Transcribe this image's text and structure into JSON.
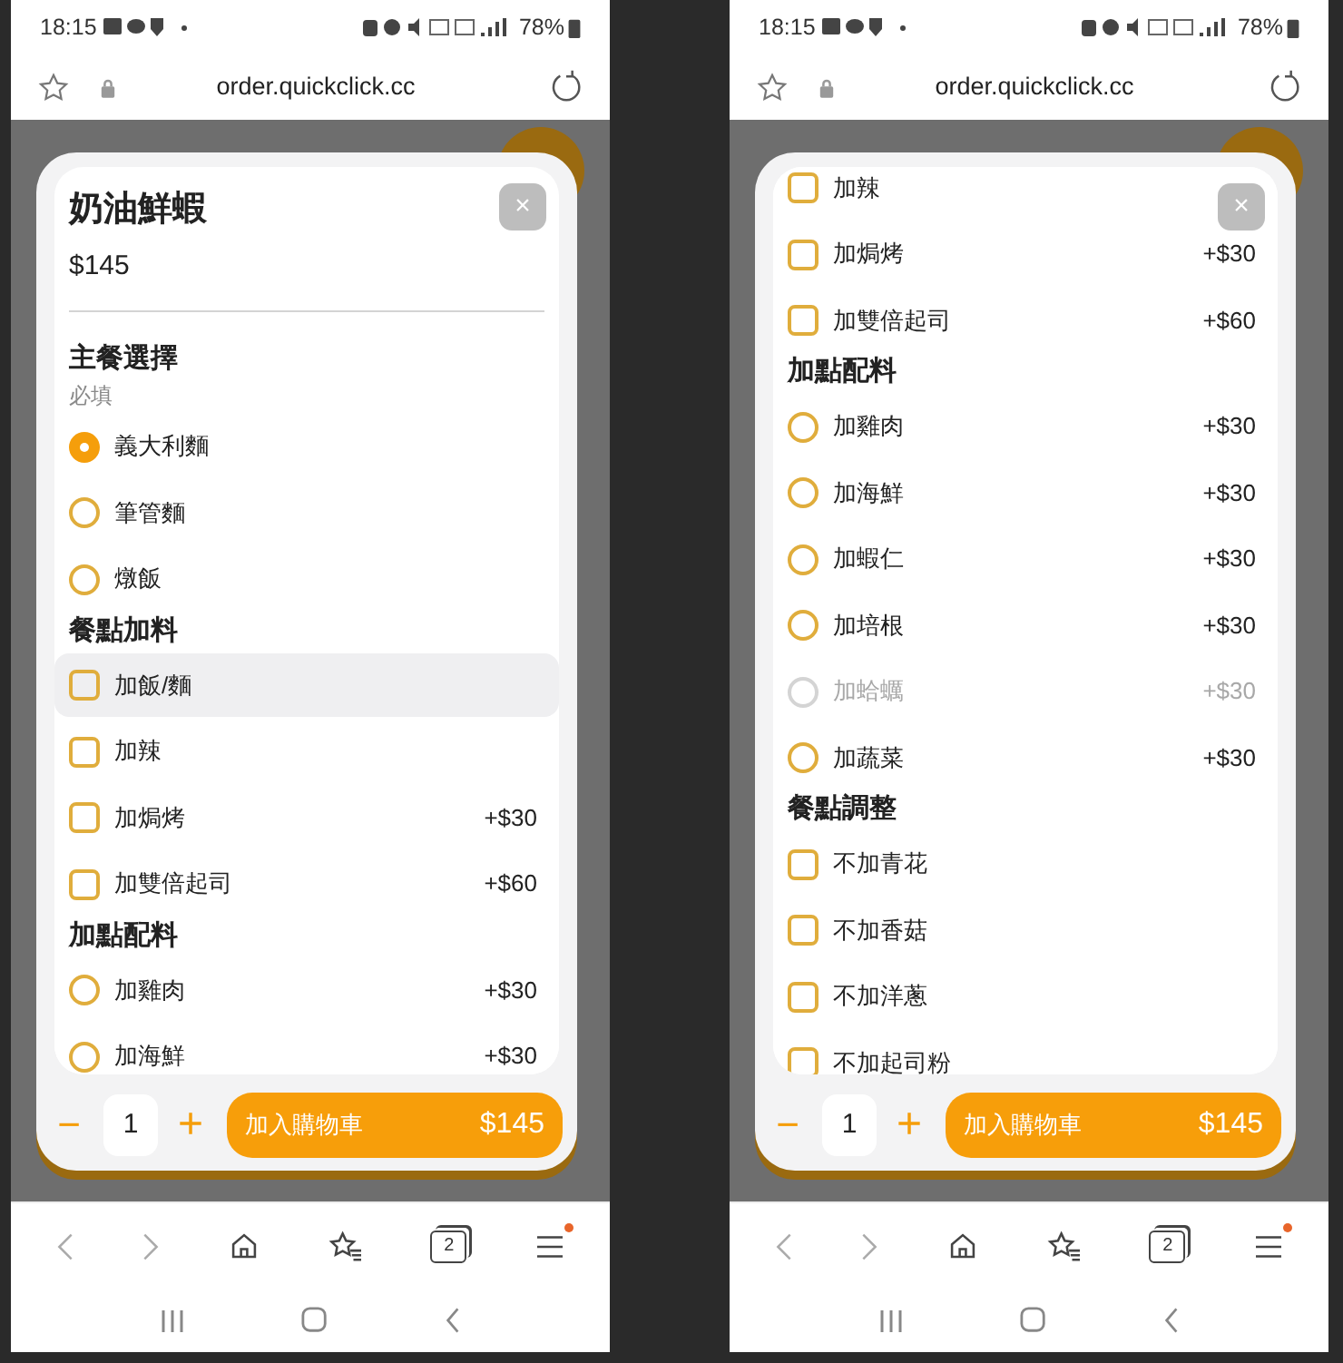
{
  "screens": [
    {
      "status_bar": {
        "time": "18:15",
        "battery": "78%"
      },
      "address_bar": {
        "url": "order.quickclick.cc"
      },
      "modal": {
        "title": "奶油鮮蝦",
        "price": "$145",
        "close": "×",
        "sections": [
          {
            "title": "主餐選擇",
            "note": "必填",
            "options": [
              {
                "kind": "radio",
                "label": "義大利麵",
                "selected": true,
                "disabled": false,
                "highlighted": false
              },
              {
                "kind": "radio",
                "label": "筆管麵",
                "selected": false,
                "disabled": false,
                "highlighted": false
              },
              {
                "kind": "radio",
                "label": "燉飯",
                "selected": false,
                "disabled": false,
                "highlighted": false
              }
            ]
          },
          {
            "title": "餐點加料",
            "options": [
              {
                "kind": "checkbox",
                "label": "加飯/麵",
                "checked": false,
                "disabled": false,
                "highlighted": true
              },
              {
                "kind": "checkbox",
                "label": "加辣",
                "checked": false,
                "disabled": false,
                "highlighted": false
              },
              {
                "kind": "checkbox",
                "label": "加焗烤",
                "price": "+$30",
                "checked": false,
                "disabled": false,
                "highlighted": false
              },
              {
                "kind": "checkbox",
                "label": "加雙倍起司",
                "price": "+$60",
                "checked": false,
                "disabled": false,
                "highlighted": false
              }
            ]
          },
          {
            "title": "加點配料",
            "options": [
              {
                "kind": "radio",
                "label": "加雞肉",
                "price": "+$30",
                "selected": false,
                "disabled": false,
                "highlighted": false
              },
              {
                "kind": "radio",
                "label": "加海鮮",
                "price": "+$30",
                "selected": false,
                "disabled": false,
                "highlighted": false
              }
            ]
          }
        ],
        "footer": {
          "minus": "−",
          "quantity": "1",
          "plus": "+",
          "add_button": "加入購物車",
          "total": "$145"
        }
      },
      "bottom_nav": {
        "tabs_count": "2"
      }
    },
    {
      "status_bar": {
        "time": "18:15",
        "battery": "78%"
      },
      "address_bar": {
        "url": "order.quickclick.cc"
      },
      "modal": {
        "close": "×",
        "sections": [
          {
            "options": [
              {
                "kind": "checkbox",
                "label": "加辣",
                "checked": false,
                "disabled": false,
                "highlighted": false
              },
              {
                "kind": "checkbox",
                "label": "加焗烤",
                "price": "+$30",
                "checked": false,
                "disabled": false,
                "highlighted": false
              },
              {
                "kind": "checkbox",
                "label": "加雙倍起司",
                "price": "+$60",
                "checked": false,
                "disabled": false,
                "highlighted": false
              }
            ]
          },
          {
            "title": "加點配料",
            "options": [
              {
                "kind": "radio",
                "label": "加雞肉",
                "price": "+$30",
                "selected": false,
                "disabled": false,
                "highlighted": false
              },
              {
                "kind": "radio",
                "label": "加海鮮",
                "price": "+$30",
                "selected": false,
                "disabled": false,
                "highlighted": false
              },
              {
                "kind": "radio",
                "label": "加蝦仁",
                "price": "+$30",
                "selected": false,
                "disabled": false,
                "highlighted": false
              },
              {
                "kind": "radio",
                "label": "加培根",
                "price": "+$30",
                "selected": false,
                "disabled": false,
                "highlighted": false
              },
              {
                "kind": "radio",
                "label": "加蛤蠣",
                "price": "+$30",
                "selected": false,
                "disabled": true,
                "highlighted": false
              },
              {
                "kind": "radio",
                "label": "加蔬菜",
                "price": "+$30",
                "selected": false,
                "disabled": false,
                "highlighted": false
              }
            ]
          },
          {
            "title": "餐點調整",
            "options": [
              {
                "kind": "checkbox",
                "label": "不加青花",
                "checked": false,
                "disabled": false,
                "highlighted": false
              },
              {
                "kind": "checkbox",
                "label": "不加香菇",
                "checked": false,
                "disabled": false,
                "highlighted": false
              },
              {
                "kind": "checkbox",
                "label": "不加洋蔥",
                "checked": false,
                "disabled": false,
                "highlighted": false
              },
              {
                "kind": "checkbox",
                "label": "不加起司粉",
                "checked": false,
                "disabled": false,
                "highlighted": false
              }
            ]
          }
        ],
        "footer": {
          "minus": "−",
          "quantity": "1",
          "plus": "+",
          "add_button": "加入購物車",
          "total": "$145"
        }
      },
      "bottom_nav": {
        "tabs_count": "2"
      }
    }
  ]
}
